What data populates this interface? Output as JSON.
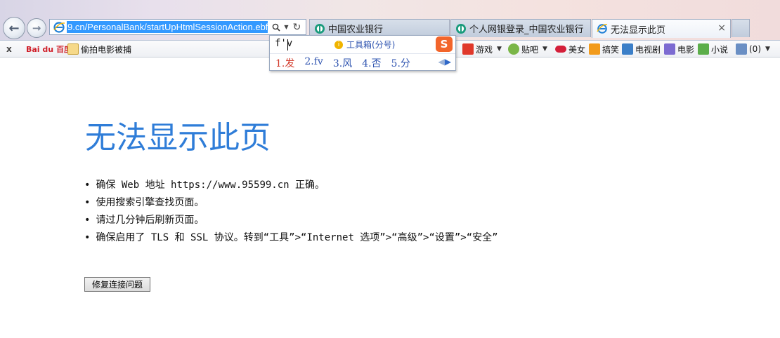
{
  "browser": {
    "address": {
      "url": "9.cn/PersonalBank/startUpHtmlSessionAction.ebf"
    },
    "tabs": [
      {
        "label": "中国农业银行",
        "active": false
      },
      {
        "label": "个人网银登录_中国农业银行",
        "active": false
      },
      {
        "label": "无法显示此页",
        "active": true,
        "close": "×"
      }
    ],
    "favorites": {
      "close_glyph": "x",
      "baidu": "Bai du 百度",
      "item_1": "偷拍电影被捕",
      "game": "游戏",
      "tieba": "贴吧",
      "beauty": "美女",
      "funny": "搞笑",
      "tv": "电视剧",
      "movie": "电影",
      "novel": "小说",
      "mail_count": "(0)"
    }
  },
  "ime": {
    "input": "f'v",
    "tools_label": "工具箱(分号)",
    "logo": "S",
    "candidates": [
      "1.发",
      "2.fv",
      "3.风",
      "4.否",
      "5.分"
    ]
  },
  "page": {
    "title": "无法显示此页",
    "bullets": [
      "确保 Web 地址 https://www.95599.cn 正确。",
      "使用搜索引擎查找页面。",
      "请过几分钟后刷新页面。",
      "确保启用了 TLS 和 SSL 协议。转到“工具”>“Internet 选项”>“高级”>“设置”>“安全”"
    ],
    "fix_button": "修复连接问题"
  },
  "colors": {
    "title_blue": "#2f7dd8",
    "url_highlight": "#3399ff",
    "ime_red": "#d23b2b",
    "ime_blue": "#2f54b0"
  }
}
